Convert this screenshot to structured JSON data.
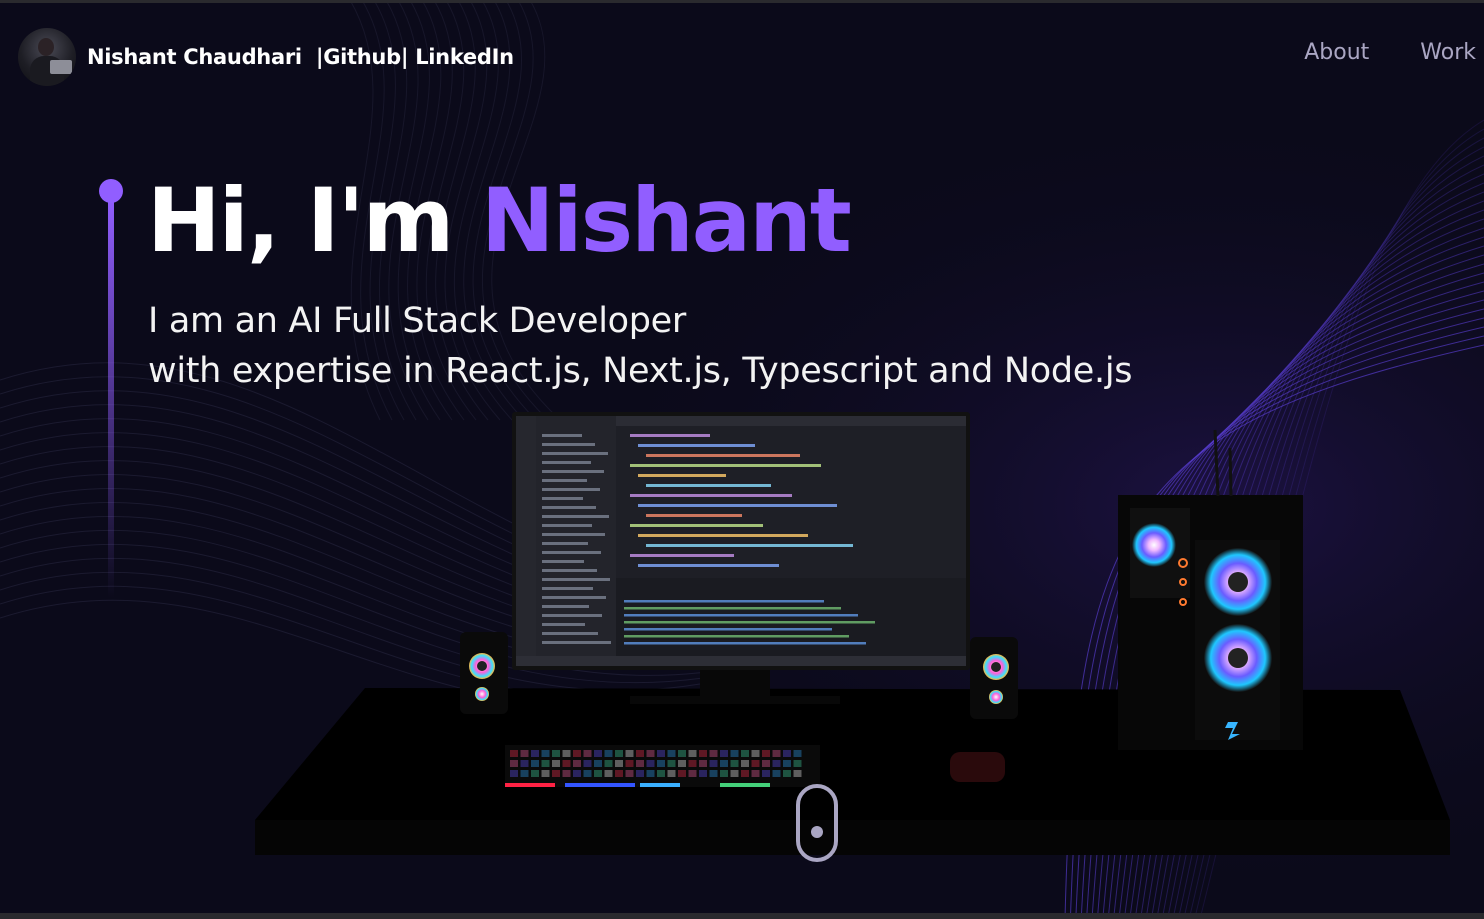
{
  "nav": {
    "brand_name": "Nishant Chaudhari",
    "brand_github": "Github",
    "brand_linkedin": "LinkedIn",
    "links": [
      "About",
      "Work"
    ]
  },
  "hero": {
    "greeting": "Hi, I'm ",
    "name": "Nishant",
    "subtitle_line1": "I am an AI Full Stack Developer",
    "subtitle_line2": "with expertise in React.js, Next.js, Typescript and Node.js"
  },
  "colors": {
    "background": "#0b0a1a",
    "accent": "#915eff",
    "nav_text": "#aaa6c3",
    "wave": "#5b3fd6"
  },
  "icons": {
    "scroll_indicator": "mouse-scroll-icon"
  }
}
